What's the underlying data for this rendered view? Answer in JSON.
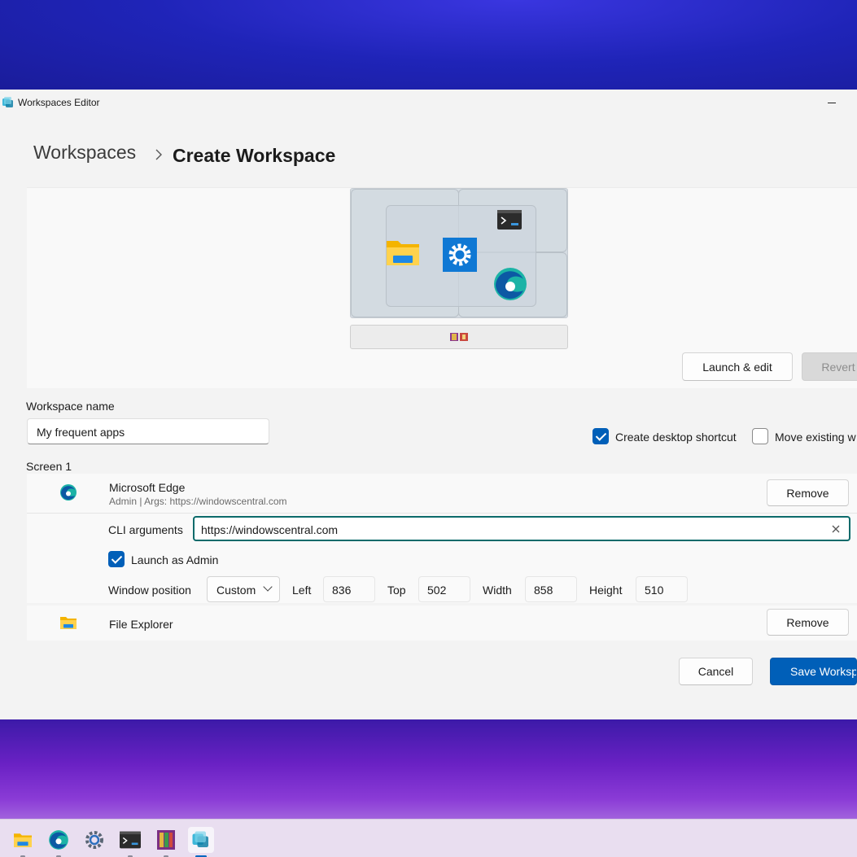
{
  "window": {
    "title": "Workspaces Editor"
  },
  "breadcrumb": {
    "root": "Workspaces",
    "separator": ">",
    "current": "Create Workspace"
  },
  "preview": {
    "launch_edit_label": "Launch & edit",
    "revert_label": "Revert"
  },
  "form": {
    "workspace_name_label": "Workspace name",
    "workspace_name_value": "My frequent apps",
    "create_shortcut_label": "Create desktop shortcut",
    "create_shortcut_checked": true,
    "move_existing_label": "Move existing w",
    "move_existing_checked": false
  },
  "screen": {
    "label": "Screen 1"
  },
  "apps": [
    {
      "name": "Microsoft Edge",
      "subtitle": "Admin | Args: https://windowscentral.com",
      "remove_label": "Remove",
      "icon": "edge-icon",
      "details": {
        "cli_label": "CLI arguments",
        "cli_value": "https://windowscentral.com",
        "launch_admin_label": "Launch as Admin",
        "launch_admin_checked": true,
        "window_position_label": "Window position",
        "window_position_value": "Custom",
        "left_label": "Left",
        "left_value": "836",
        "top_label": "Top",
        "top_value": "502",
        "width_label": "Width",
        "width_value": "858",
        "height_label": "Height",
        "height_value": "510"
      }
    },
    {
      "name": "File Explorer",
      "remove_label": "Remove",
      "icon": "folder-icon"
    }
  ],
  "footer": {
    "cancel_label": "Cancel",
    "save_label": "Save Workspa"
  },
  "taskbar": {
    "items": [
      "file-explorer-icon",
      "edge-icon",
      "settings-icon",
      "terminal-icon",
      "winrar-icon",
      "workspaces-icon"
    ]
  },
  "colors": {
    "accent": "#005fb8",
    "focus_border": "#0c6b6b"
  }
}
